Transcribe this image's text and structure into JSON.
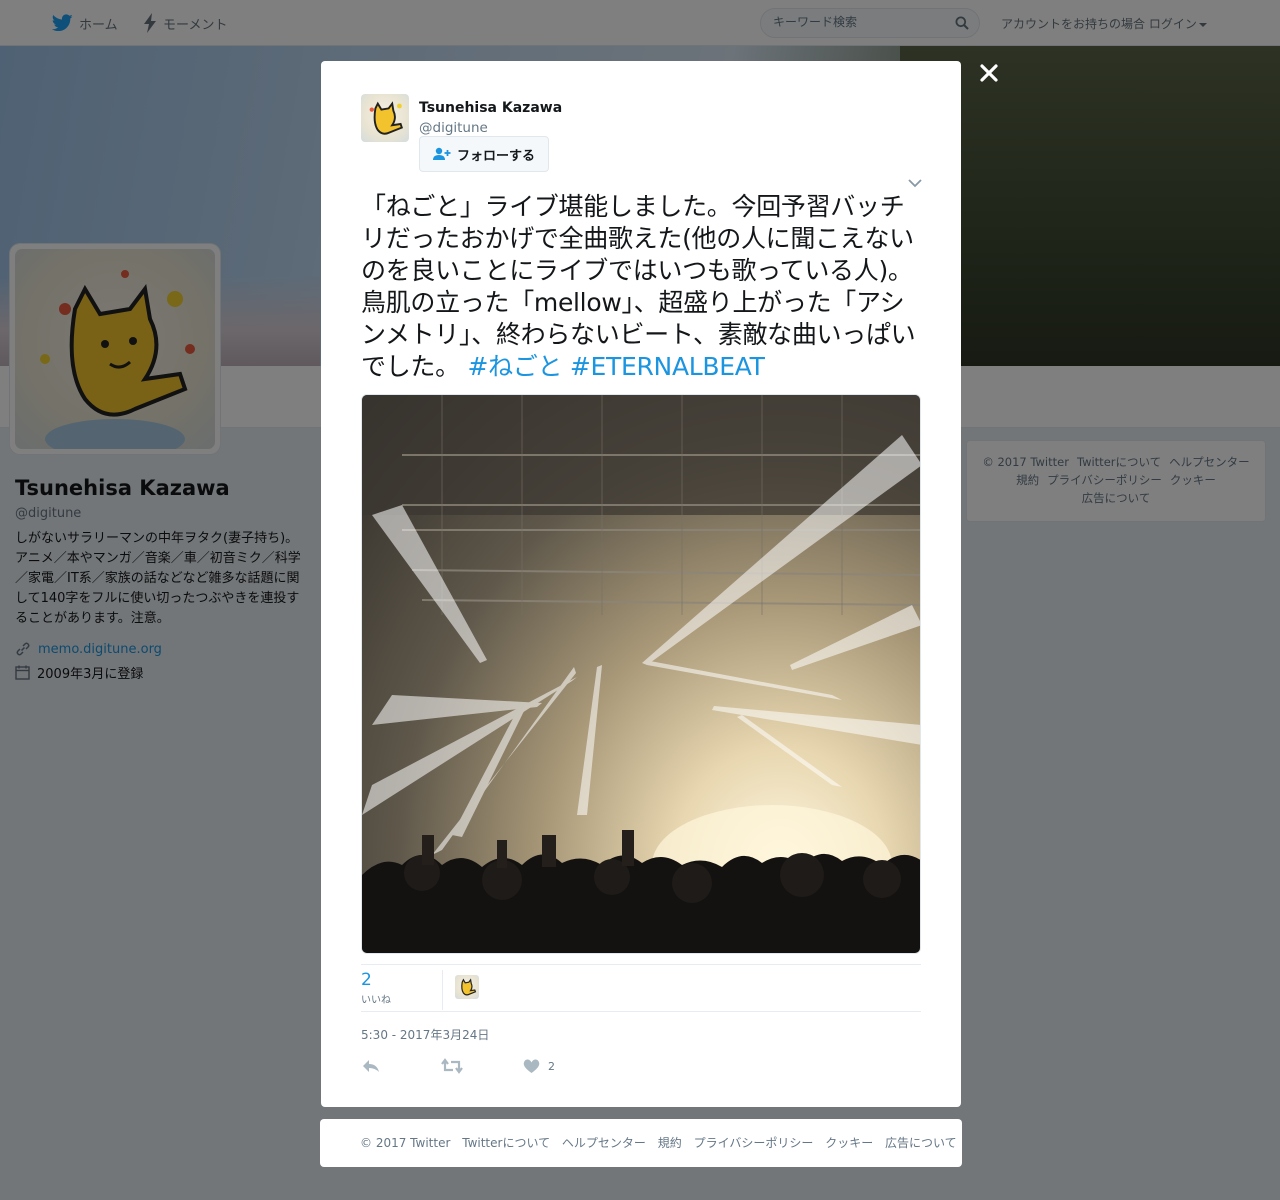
{
  "topbar": {
    "home_label": "ホーム",
    "moments_label": "モーメント",
    "search_placeholder": "キーワード検索",
    "login_prompt": "アカウントをお持ちの場合",
    "login_label": "ログイン"
  },
  "profile": {
    "name": "Tsunehisa Kazawa",
    "handle": "@digitune",
    "bio": "しがないサラリーマンの中年ヲタク(妻子持ち)。アニメ／本やマンガ／音楽／車／初音ミク／科学／家電／IT系／家族の話などなど雑多な話題に関して140字をフルに使い切ったつぶやきを連投することがあります。注意。",
    "url": "memo.digitune.org",
    "joined": "2009年3月に登録"
  },
  "side_footer": {
    "line1": [
      "© 2017 Twitter",
      "Twitterについて",
      "ヘルプセンター"
    ],
    "line2": [
      "規約",
      "プライバシーポリシー",
      "クッキー"
    ],
    "line3": [
      "広告について"
    ]
  },
  "tweet": {
    "author_name": "Tsunehisa Kazawa",
    "author_handle": "@digitune",
    "follow_label": "フォローする",
    "text": "「ねごと」ライブ堪能しました。今回予習バッチリだったおかげで全曲歌えた(他の人に聞こえないのを良いことにライブではいつも歌っている人)。鳥肌の立った「mellow」、超盛り上がった「アシンメトリ」、終わらないビート、素敵な曲いっぱいでした。",
    "hashtag1": "#ねごと",
    "hashtag2": "#ETERNALBEAT",
    "likes_count": "2",
    "likes_label": "いいね",
    "timestamp": "5:30 - 2017年3月24日",
    "like_action_count": "2"
  },
  "modal_footer": {
    "links": [
      "© 2017 Twitter",
      "Twitterについて",
      "ヘルプセンター",
      "規約",
      "プライバシーポリシー",
      "クッキー",
      "広告について"
    ]
  },
  "colors": {
    "accent": "#1b95e0",
    "overlay": "rgba(0,0,0,0.5)",
    "page_bg": "#e6ecf0"
  },
  "icons": [
    "twitter-bird-icon",
    "lightning-icon",
    "search-icon",
    "caret-down-icon",
    "close-icon",
    "add-user-icon",
    "chevron-down-icon",
    "link-icon",
    "calendar-icon",
    "reply-icon",
    "retweet-icon",
    "heart-icon"
  ]
}
